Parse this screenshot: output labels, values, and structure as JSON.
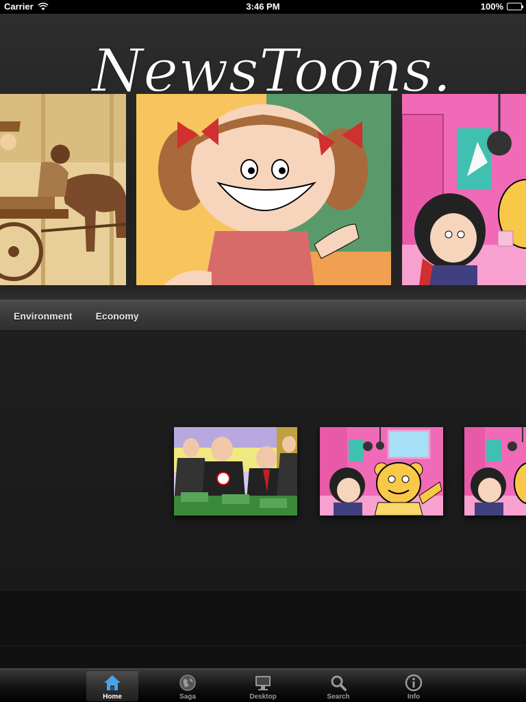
{
  "status_bar": {
    "carrier": "Carrier",
    "time": "3:46 PM",
    "battery": "100%",
    "battery_level": 1.0
  },
  "app": {
    "logo_text": "NewsToons."
  },
  "carousel": {
    "panels": [
      {
        "name": "western-cart-cartoon"
      },
      {
        "name": "smiling-girl-cartoon"
      },
      {
        "name": "bedroom-girl-cartoon"
      }
    ]
  },
  "categories": {
    "items": [
      {
        "label": "Environment"
      },
      {
        "label": "Economy"
      }
    ]
  },
  "thumbnails": [
    {
      "name": "politicians-money-cartoon"
    },
    {
      "name": "girl-and-bear-cartoon"
    },
    {
      "name": "girl-and-bear-cartoon-2"
    }
  ],
  "tabbar": {
    "tabs": [
      {
        "label": "Home",
        "icon": "home-icon",
        "active": true
      },
      {
        "label": "Saga",
        "icon": "globe-icon",
        "active": false
      },
      {
        "label": "Desktop",
        "icon": "monitor-icon",
        "active": false
      },
      {
        "label": "Search",
        "icon": "search-icon",
        "active": false
      },
      {
        "label": "Info",
        "icon": "info-icon",
        "active": false
      }
    ]
  },
  "colors": {
    "accent_blue": "#4aa3e8",
    "background": "#1c1c1c"
  }
}
